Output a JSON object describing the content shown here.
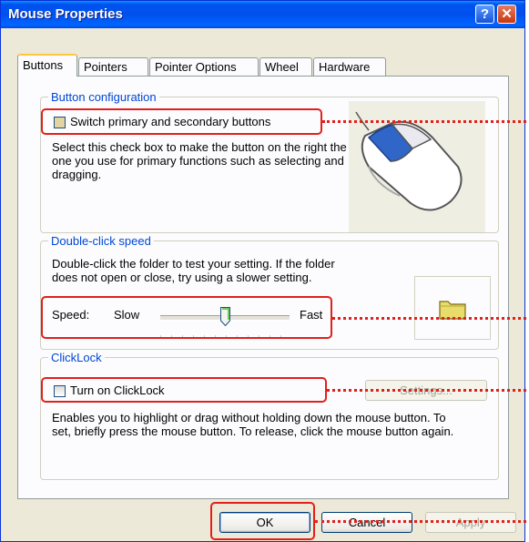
{
  "window": {
    "title": "Mouse Properties",
    "help_glyph": "?",
    "close_glyph": "✕"
  },
  "tabs": [
    {
      "label": "Buttons",
      "active": true
    },
    {
      "label": "Pointers",
      "active": false
    },
    {
      "label": "Pointer Options",
      "active": false
    },
    {
      "label": "Wheel",
      "active": false
    },
    {
      "label": "Hardware",
      "active": false
    }
  ],
  "button_config": {
    "title": "Button configuration",
    "checkbox_label": "Switch primary and secondary buttons",
    "checked": false,
    "description": "Select this check box to make the button on the right the one you use for primary functions such as selecting and dragging."
  },
  "double_click": {
    "title": "Double-click speed",
    "description": "Double-click the folder to test your setting. If the folder does not open or close, try using a slower setting.",
    "speed_label": "Speed:",
    "slow_label": "Slow",
    "fast_label": "Fast",
    "slider_value_fraction": 0.5
  },
  "clicklock": {
    "title": "ClickLock",
    "checkbox_label": "Turn on ClickLock",
    "checked": false,
    "settings_label": "Settings...",
    "description": "Enables you to highlight or drag without holding down the mouse button. To set, briefly press the mouse button. To release, click the mouse button again."
  },
  "footer": {
    "ok_label": "OK",
    "cancel_label": "Cancel",
    "apply_label": "Apply"
  },
  "colors": {
    "highlight": "#e0201c",
    "title_bar": "#0054e3",
    "group_title": "#0046d5"
  }
}
